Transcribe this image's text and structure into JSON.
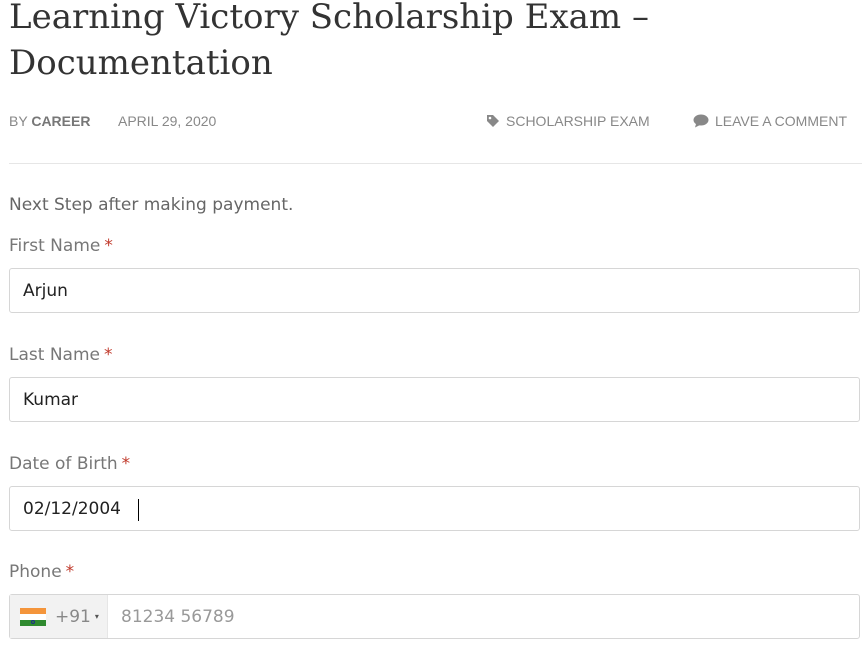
{
  "post": {
    "title": "Learning Victory Scholarship Exam – Documentation",
    "by_prefix": "BY",
    "author": "CAREER",
    "date": "APRIL 29, 2020",
    "category": "SCHOLARSHIP EXAM",
    "comment_link": "LEAVE A COMMENT",
    "intro": "Next Step after making payment."
  },
  "form": {
    "required_mark": "*",
    "first_name": {
      "label": "First Name",
      "value": "Arjun"
    },
    "last_name": {
      "label": "Last Name",
      "value": "Kumar"
    },
    "dob": {
      "label": "Date of Birth",
      "value": "02/12/2004"
    },
    "phone": {
      "label": "Phone",
      "country_code": "+91",
      "country_arrow": "▾",
      "placeholder": "81234 56789"
    }
  },
  "icons": {
    "category": "tag-icon",
    "comment": "comment-icon",
    "flag": "india-flag-icon"
  },
  "colors": {
    "required": "#c0392b",
    "title": "#333333",
    "meta": "#888888"
  }
}
